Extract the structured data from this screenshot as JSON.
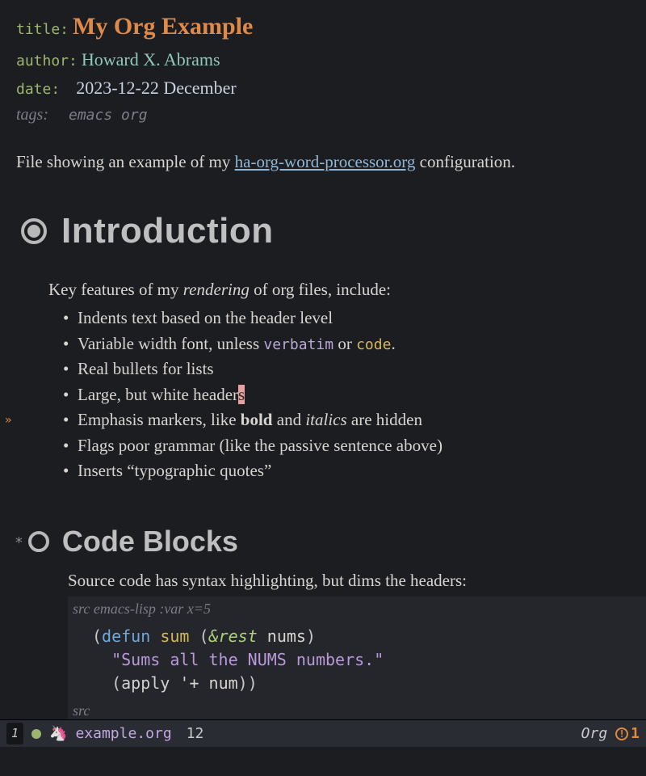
{
  "meta": {
    "title_key": "title:",
    "title": "My Org Example",
    "author_key": "author:",
    "author": "Howard X. Abrams",
    "date_key": "date:",
    "date": "2023-12-22 December",
    "tags_key": "tags:",
    "tags": "emacs org"
  },
  "intro": {
    "pre": "File showing an example of my ",
    "link": "ha-org-word-processor.org",
    "post": " configuration."
  },
  "h1": "Introduction",
  "features_lead_pre": "Key features of my ",
  "features_lead_em": "rendering",
  "features_lead_post": " of org files, include:",
  "features": {
    "f0": "Indents text based on the header level",
    "f1_pre": "Variable width font, unless ",
    "f1_verbatim": "verbatim",
    "f1_mid": " or ",
    "f1_code": "code",
    "f1_post": ".",
    "f2": "Real bullets for lists",
    "f3_pre": "Large, but white header",
    "f3_cursor": "s",
    "f4_pre": "Emphasis markers, like ",
    "f4_bold": "bold",
    "f4_mid": " and ",
    "f4_italic": "italics",
    "f4_post": " are hidden",
    "f5": "Flags poor grammar (like the passive sentence above)",
    "f6": "Inserts “typographic quotes”"
  },
  "h2_star": "*",
  "h2": "Code Blocks",
  "code_intro": "Source code has syntax highlighting, but dims the headers:",
  "src_begin_label": "src",
  "src_lang": " emacs-lisp :var x=5",
  "src_end_label": "src",
  "code": {
    "l1_open": "(",
    "l1_defun": "defun",
    "l1_sp1": " ",
    "l1_name": "sum",
    "l1_sp2": " (",
    "l1_rest": "&rest",
    "l1_sp3": " ",
    "l1_arg": "nums",
    "l1_close": ")",
    "l2_doc": "\"Sums all the NUMS numbers.\"",
    "l3_open": "(",
    "l3_apply": "apply",
    "l3_mid": " '+ ",
    "l3_arg": "num",
    "l3_close": "))"
  },
  "modeline": {
    "winnum": "1",
    "unicorn": "🦄",
    "filename": "example.org",
    "line": "12",
    "mode": "Org",
    "warn_count": "1"
  }
}
